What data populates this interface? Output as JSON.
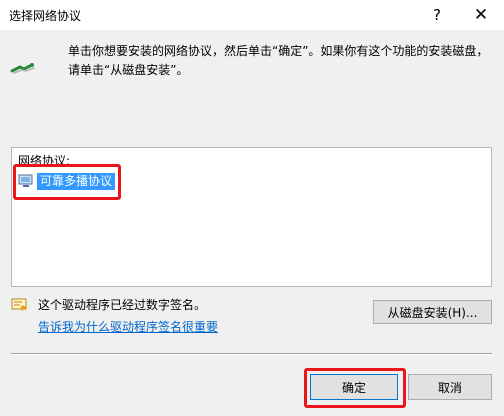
{
  "window": {
    "title": "选择网络协议",
    "help_glyph": "?",
    "close_glyph": "✕"
  },
  "instruction": "单击你想要安装的网络协议，然后单击“确定”。如果你有这个功能的安装磁盘，请单击“从磁盘安装”。",
  "protocol_list": {
    "header": "网络协议:",
    "items": [
      {
        "label": "可靠多播协议",
        "selected": true
      }
    ]
  },
  "signature": {
    "status_text": "这个驱动程序已经过数字签名。",
    "link_text": "告诉我为什么驱动程序签名很重要"
  },
  "buttons": {
    "from_disk": "从磁盘安装(H)...",
    "ok": "确定",
    "cancel": "取消"
  },
  "colors": {
    "selection": "#3399ff",
    "highlight_box": "#e8151b",
    "link": "#0066cc"
  }
}
